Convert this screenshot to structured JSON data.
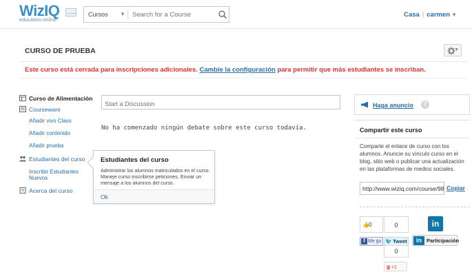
{
  "brand": {
    "logo_text": "WizIQ",
    "logo_sub": "education.online"
  },
  "search": {
    "category": "Cursos",
    "placeholder": "Search for a Course"
  },
  "user": {
    "home_label": "Casa",
    "separator": "|",
    "username": "carmen"
  },
  "course": {
    "title": "CURSO DE PRUEBA",
    "alert_prefix": "Este curso está cerrada para inscripciones adicionales.",
    "alert_link": "Cambie la configuración",
    "alert_suffix": "para permitir que más estudiantes se inscriban."
  },
  "sidebar": {
    "items": [
      {
        "label": "Curso de Alimentación",
        "icon": "course-feed-icon"
      },
      {
        "label": "Courseware",
        "icon": "courseware-icon"
      },
      {
        "label": "Añadir vivo Class"
      },
      {
        "label": "Añadir contenido"
      },
      {
        "label": "Añadir prueba"
      },
      {
        "label": "Estudiantes del curso",
        "icon": "students-icon"
      },
      {
        "label": "Inscribir Estudiantes Nuevos"
      },
      {
        "label": "Acerca del curso",
        "icon": "about-icon"
      }
    ]
  },
  "discussion": {
    "placeholder": "Start a Discussion",
    "empty_text": "No ha comenzado ningún debate sobre este curso todavía."
  },
  "popover": {
    "title": "Estudiantes del curso",
    "body": "Administrar los alumnos matriculados en el curso. Maneje curso inscribirse peticiones. Enviar un mensaje a los alumnos del curso.",
    "ok_label": "Ok"
  },
  "announce": {
    "label": "Haga anuncio",
    "help": "?"
  },
  "share": {
    "heading": "Compartir este curso",
    "description": "Comparte el enlace de curso con los alumnos. Anuncie su vínculo curso en el blog, sitio web o publicar una actualización en las plataformas de medios sociales.",
    "url": "http://www.wiziq.com/course/98",
    "copy_label": "Copiar"
  },
  "social": {
    "fb_count": "0",
    "tw_count": "0",
    "fb_like_label": "Me gu",
    "tw_label": "Tweet",
    "li_label": "Participación",
    "li_logo": "in",
    "gp_count": "0",
    "gp_label": "+1",
    "gp_logo": "g"
  },
  "colors": {
    "link": "#2a6ea6",
    "alert": "#dd3333",
    "brand": "#3a8fc7",
    "linkedin": "#0e76a8",
    "facebook": "#3b5998"
  }
}
